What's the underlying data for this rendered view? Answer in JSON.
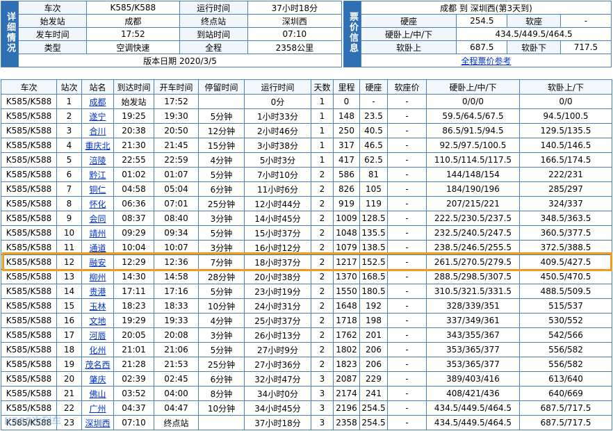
{
  "info": {
    "side_label": "详细情况",
    "rows": [
      {
        "l1": "车次",
        "v1": "K585/K588",
        "l2": "运行时间",
        "v2": "37小时18分"
      },
      {
        "l1": "始发站",
        "v1": "成都",
        "l2": "终点站",
        "v2": "深圳西"
      },
      {
        "l1": "发车时间",
        "v1": "17:52",
        "l2": "到站时间",
        "v2": "07:10"
      },
      {
        "l1": "类型",
        "v1": "空调快速",
        "l2": "全程",
        "v2": "2358公里"
      }
    ],
    "version": "版本日期 2020/3/5"
  },
  "price": {
    "side_label": "票价信息",
    "route": "成都 到 深圳西(第3天到)",
    "rows": [
      {
        "l1": "硬座",
        "v1": "254.5",
        "l2": "软座",
        "v2": "-"
      },
      {
        "l1": "硬卧上/中/下",
        "v1": "434.5/449.5/464.5"
      },
      {
        "l1": "软卧上",
        "v1": "687.5",
        "l2": "软卧下",
        "v2": "717.5"
      }
    ],
    "link": "全程票价参考"
  },
  "schedule": {
    "headers": [
      "车次",
      "站次",
      "站名",
      "到达时间",
      "开车时间",
      "停留时间",
      "运行时间",
      "天数",
      "里程",
      "硬座",
      "软座价",
      "硬卧上/中/下",
      "软卧上/下"
    ],
    "highlight_row": 11,
    "rows": [
      [
        "K585/K588",
        "1",
        "成都",
        "始发站",
        "17:52",
        "",
        "0分",
        "1",
        "0",
        "-",
        "-",
        "0/0/0",
        "0/0"
      ],
      [
        "K585/K588",
        "2",
        "遂宁",
        "19:25",
        "19:30",
        "5分钟",
        "1小时33分",
        "1",
        "148",
        "23.5",
        "-",
        "59.5/64.5/67.5",
        "94.5/100.5"
      ],
      [
        "K585/K588",
        "3",
        "合川",
        "20:38",
        "20:50",
        "12分钟",
        "2小时46分",
        "1",
        "250",
        "40.5",
        "-",
        "86.5/91.5/94.5",
        "129.5/135.5"
      ],
      [
        "K585/K588",
        "4",
        "重庆北",
        "21:30",
        "21:45",
        "15分钟",
        "3小时38分",
        "1",
        "317",
        "46.5",
        "-",
        "92.5/97.5/100.5",
        "140.5/146.5"
      ],
      [
        "K585/K588",
        "5",
        "涪陵",
        "22:55",
        "22:59",
        "4分钟",
        "5小时3分",
        "1",
        "417",
        "62.5",
        "-",
        "110.5/114.5/117.5",
        "166.5/174.5"
      ],
      [
        "K585/K588",
        "6",
        "黔江",
        "01:02",
        "01:07",
        "5分钟",
        "7小时10分",
        "2",
        "586",
        "81",
        "-",
        "144/148/154",
        "222/231"
      ],
      [
        "K585/K588",
        "7",
        "铜仁",
        "04:58",
        "05:04",
        "6分钟",
        "11小时6分",
        "2",
        "826",
        "105",
        "-",
        "184/190/196",
        "285/297"
      ],
      [
        "K585/K588",
        "8",
        "怀化",
        "06:36",
        "07:01",
        "25分钟",
        "12小时44分",
        "2",
        "919",
        "119",
        "-",
        "207/215/221",
        "324/337"
      ],
      [
        "K585/K588",
        "9",
        "会同",
        "08:37",
        "08:40",
        "3分钟",
        "14小时45分",
        "2",
        "1009",
        "128.5",
        "-",
        "222.5/230.5/237.5",
        "348.5/363.5"
      ],
      [
        "K585/K588",
        "10",
        "靖州",
        "09:29",
        "09:34",
        "5分钟",
        "15小时37分",
        "2",
        "1048",
        "135.5",
        "-",
        "232.5/240.5/247.5",
        "360.5/377.5"
      ],
      [
        "K585/K588",
        "11",
        "通道",
        "10:04",
        "10:07",
        "3分钟",
        "16小时12分",
        "2",
        "1079",
        "138.5",
        "-",
        "238.5/246.5/255.5",
        "372.5/388.5"
      ],
      [
        "K585/K588",
        "12",
        "融安",
        "12:29",
        "12:36",
        "7分钟",
        "18小时37分",
        "2",
        "1217",
        "152.5",
        "-",
        "261.5/270.5/279.5",
        "409.5/427.5"
      ],
      [
        "K585/K588",
        "13",
        "柳州",
        "14:30",
        "14:58",
        "28分钟",
        "20小时38分",
        "2",
        "1370",
        "168.5",
        "-",
        "288.5/298.5/307.5",
        "450.5/470.5"
      ],
      [
        "K585/K588",
        "14",
        "贵港",
        "17:11",
        "17:16",
        "5分钟",
        "23小时19分",
        "2",
        "1550",
        "180.5",
        "-",
        "310.5/321.5/331.5",
        "488.5/509.5"
      ],
      [
        "K585/K588",
        "15",
        "玉林",
        "18:23",
        "18:33",
        "10分钟",
        "24小时31分",
        "2",
        "1648",
        "192",
        "-",
        "328/339/351",
        "515/537"
      ],
      [
        "K585/K588",
        "16",
        "文地",
        "19:29",
        "19:33",
        "4分钟",
        "25小时37分",
        "2",
        "1718",
        "198",
        "-",
        "337/349/361",
        "530/552"
      ],
      [
        "K585/K588",
        "17",
        "河唇",
        "20:05",
        "20:08",
        "3分钟",
        "26小时13分",
        "2",
        "1762",
        "201",
        "-",
        "343/355/367",
        "542/566"
      ],
      [
        "K585/K588",
        "18",
        "化州",
        "21:01",
        "21:06",
        "5分钟",
        "27小时9分",
        "2",
        "1802",
        "206",
        "-",
        "353/365/377",
        "556/582"
      ],
      [
        "K585/K588",
        "19",
        "茂名西",
        "21:28",
        "21:53",
        "25分钟",
        "27小时36分",
        "2",
        "1823",
        "206",
        "-",
        "353/365/377",
        "556/582"
      ],
      [
        "K585/K588",
        "20",
        "肇庆",
        "02:39",
        "02:45",
        "6分钟",
        "32小时47分",
        "3",
        "2087",
        "229",
        "-",
        "389/403/416",
        "613/640"
      ],
      [
        "K585/K588",
        "21",
        "佛山",
        "03:52",
        "04:00",
        "8分钟",
        "34小时0分",
        "3",
        "2174",
        "241",
        "-",
        "408/421/436",
        "640/669"
      ],
      [
        "K585/K588",
        "22",
        "广州",
        "04:37",
        "04:47",
        "10分钟",
        "34小时45分",
        "3",
        "2196",
        "254.5",
        "-",
        "434.5/449.5/464.5",
        "687.5/717.5"
      ],
      [
        "K585/K588",
        "23",
        "深圳西",
        "07:10",
        "终点站",
        "",
        "37小时18分",
        "3",
        "2358",
        "254.5",
        "-",
        "434.5/449.5/464.5",
        "687.5/717.5"
      ]
    ]
  },
  "colors": {
    "header_blue": "#2f6fb3",
    "border": "#4b7fb8",
    "link": "#0033cc",
    "highlight": "#f39a16"
  },
  "watermark": "K585次列车"
}
